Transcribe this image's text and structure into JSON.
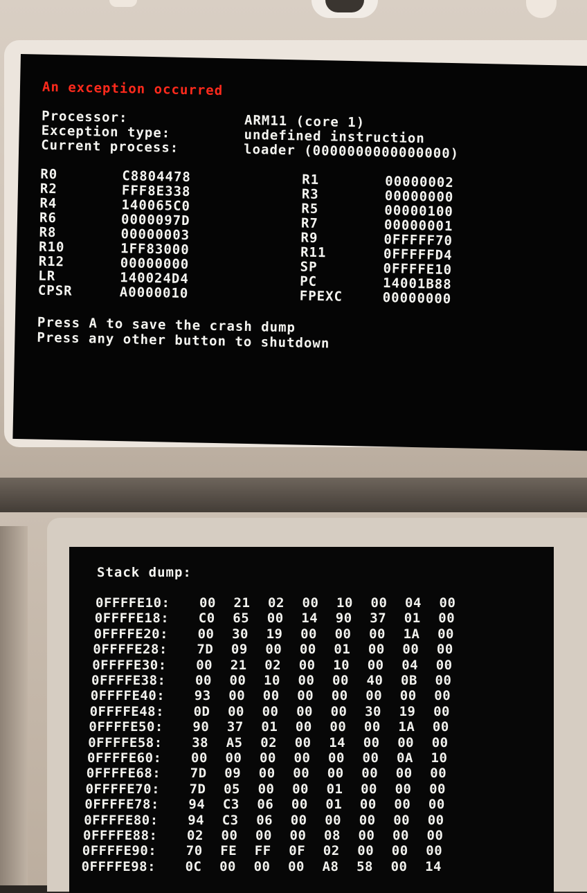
{
  "top_screen": {
    "title": "An exception occurred",
    "info": [
      {
        "label": "Processor:",
        "value": "ARM11 (core 1)"
      },
      {
        "label": "Exception type:",
        "value": "undefined instruction"
      },
      {
        "label": "Current process:",
        "value": "loader (0000000000000000)"
      }
    ],
    "registers_left": [
      {
        "name": "R0",
        "value": "C8804478"
      },
      {
        "name": "R2",
        "value": "FFF8E338"
      },
      {
        "name": "R4",
        "value": "140065C0"
      },
      {
        "name": "R6",
        "value": "0000097D"
      },
      {
        "name": "R8",
        "value": "00000003"
      },
      {
        "name": "R10",
        "value": "1FF83000"
      },
      {
        "name": "R12",
        "value": "00000000"
      },
      {
        "name": "LR",
        "value": "140024D4"
      },
      {
        "name": "CPSR",
        "value": "A0000010"
      }
    ],
    "registers_right": [
      {
        "name": "R1",
        "value": "00000002"
      },
      {
        "name": "R3",
        "value": "00000000"
      },
      {
        "name": "R5",
        "value": "00000100"
      },
      {
        "name": "R7",
        "value": "00000001"
      },
      {
        "name": "R9",
        "value": "0FFFFF70"
      },
      {
        "name": "R11",
        "value": "0FFFFFD4"
      },
      {
        "name": "SP",
        "value": "0FFFFE10"
      },
      {
        "name": "PC",
        "value": "14001B88"
      },
      {
        "name": "FPEXC",
        "value": "00000000"
      }
    ],
    "prompt_save": "Press A to save the crash dump",
    "prompt_shutdown": "Press any other button to shutdown"
  },
  "bottom_screen": {
    "title": "Stack dump:",
    "rows": [
      {
        "addr": "0FFFFE10:",
        "bytes": [
          "00",
          "21",
          "02",
          "00",
          "10",
          "00",
          "04",
          "00"
        ]
      },
      {
        "addr": "0FFFFE18:",
        "bytes": [
          "C0",
          "65",
          "00",
          "14",
          "90",
          "37",
          "01",
          "00"
        ]
      },
      {
        "addr": "0FFFFE20:",
        "bytes": [
          "00",
          "30",
          "19",
          "00",
          "00",
          "00",
          "1A",
          "00"
        ]
      },
      {
        "addr": "0FFFFE28:",
        "bytes": [
          "7D",
          "09",
          "00",
          "00",
          "01",
          "00",
          "00",
          "00"
        ]
      },
      {
        "addr": "0FFFFE30:",
        "bytes": [
          "00",
          "21",
          "02",
          "00",
          "10",
          "00",
          "04",
          "00"
        ]
      },
      {
        "addr": "0FFFFE38:",
        "bytes": [
          "00",
          "00",
          "10",
          "00",
          "00",
          "40",
          "0B",
          "00"
        ]
      },
      {
        "addr": "0FFFFE40:",
        "bytes": [
          "93",
          "00",
          "00",
          "00",
          "00",
          "00",
          "00",
          "00"
        ]
      },
      {
        "addr": "0FFFFE48:",
        "bytes": [
          "0D",
          "00",
          "00",
          "00",
          "00",
          "30",
          "19",
          "00"
        ]
      },
      {
        "addr": "0FFFFE50:",
        "bytes": [
          "90",
          "37",
          "01",
          "00",
          "00",
          "00",
          "1A",
          "00"
        ]
      },
      {
        "addr": "0FFFFE58:",
        "bytes": [
          "38",
          "A5",
          "02",
          "00",
          "14",
          "00",
          "00",
          "00"
        ]
      },
      {
        "addr": "0FFFFE60:",
        "bytes": [
          "00",
          "00",
          "00",
          "00",
          "00",
          "00",
          "0A",
          "10"
        ]
      },
      {
        "addr": "0FFFFE68:",
        "bytes": [
          "7D",
          "09",
          "00",
          "00",
          "00",
          "00",
          "00",
          "00"
        ]
      },
      {
        "addr": "0FFFFE70:",
        "bytes": [
          "7D",
          "05",
          "00",
          "00",
          "01",
          "00",
          "00",
          "00"
        ]
      },
      {
        "addr": "0FFFFE78:",
        "bytes": [
          "94",
          "C3",
          "06",
          "00",
          "01",
          "00",
          "00",
          "00"
        ]
      },
      {
        "addr": "0FFFFE80:",
        "bytes": [
          "94",
          "C3",
          "06",
          "00",
          "00",
          "00",
          "00",
          "00"
        ]
      },
      {
        "addr": "0FFFFE88:",
        "bytes": [
          "02",
          "00",
          "00",
          "00",
          "08",
          "00",
          "00",
          "00"
        ]
      },
      {
        "addr": "0FFFFE90:",
        "bytes": [
          "70",
          "FE",
          "FF",
          "0F",
          "02",
          "00",
          "00",
          "00"
        ]
      },
      {
        "addr": "0FFFFE98:",
        "bytes": [
          "0C",
          "00",
          "00",
          "00",
          "A8",
          "58",
          "00",
          "14"
        ]
      }
    ]
  },
  "colors": {
    "title_red": "#ff2a1c",
    "screen_text": "#f4f4f0",
    "screen_bg": "#050505",
    "device_shell": "#d9cfc4"
  }
}
